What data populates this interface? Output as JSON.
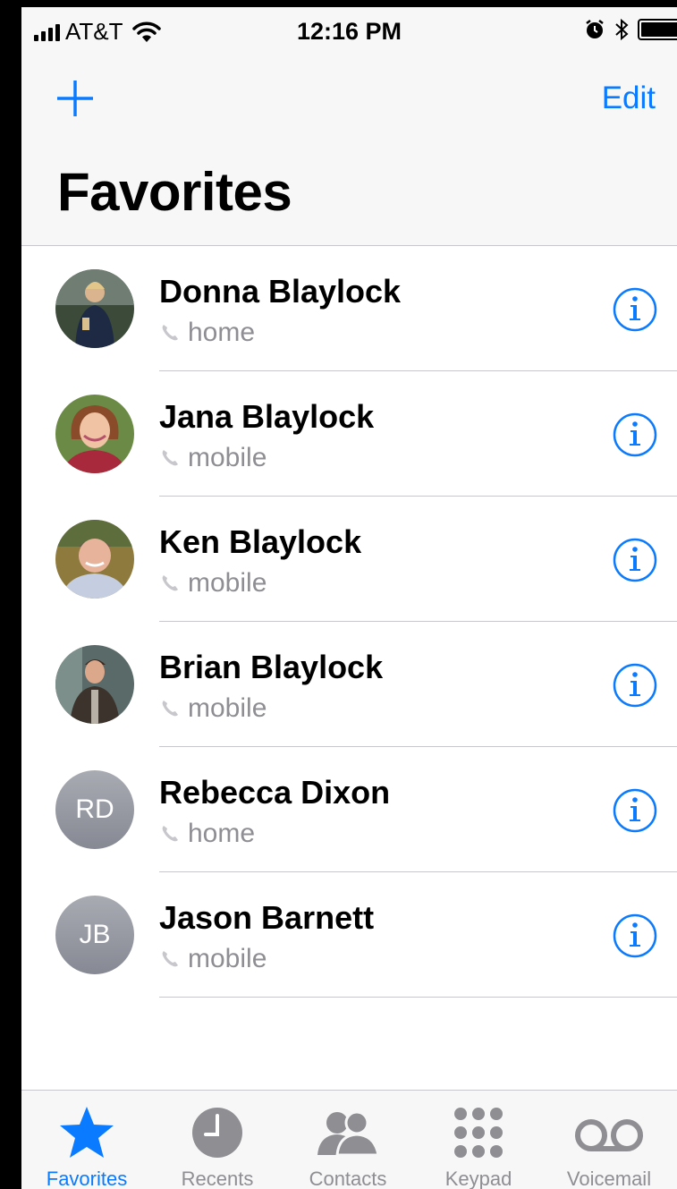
{
  "status_bar": {
    "carrier": "AT&T",
    "time": "12:16 PM",
    "icons": [
      "signal-bars-icon",
      "wifi-icon",
      "alarm-icon",
      "bluetooth-icon",
      "battery-icon"
    ]
  },
  "nav": {
    "add_icon": "plus-icon",
    "edit_label": "Edit",
    "title": "Favorites"
  },
  "favorites": [
    {
      "name": "Donna Blaylock",
      "type": "home",
      "avatar": "photo"
    },
    {
      "name": "Jana Blaylock",
      "type": "mobile",
      "avatar": "photo"
    },
    {
      "name": "Ken Blaylock",
      "type": "mobile",
      "avatar": "photo"
    },
    {
      "name": "Brian Blaylock",
      "type": "mobile",
      "avatar": "photo"
    },
    {
      "name": "Rebecca Dixon",
      "type": "home",
      "avatar": "initials",
      "initials": "RD"
    },
    {
      "name": "Jason Barnett",
      "type": "mobile",
      "avatar": "initials",
      "initials": "JB"
    }
  ],
  "tabs": [
    {
      "label": "Favorites",
      "icon": "star-icon",
      "active": true
    },
    {
      "label": "Recents",
      "icon": "clock-icon",
      "active": false
    },
    {
      "label": "Contacts",
      "icon": "contacts-icon",
      "active": false
    },
    {
      "label": "Keypad",
      "icon": "keypad-icon",
      "active": false
    },
    {
      "label": "Voicemail",
      "icon": "voicemail-icon",
      "active": false
    }
  ],
  "colors": {
    "accent": "#0a7aff",
    "secondary_text": "#8e8e93",
    "separator": "#c8c7cc",
    "bar_background": "#f7f7f7"
  }
}
